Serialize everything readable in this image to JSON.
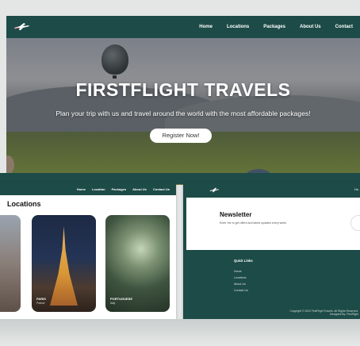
{
  "nav": {
    "links": [
      "Home",
      "Locations",
      "Packages",
      "About Us",
      "Contact"
    ]
  },
  "hero": {
    "title": "FIRSTFLIGHT TRAVELS",
    "subtitle": "Plan your trip with us and travel around the world with the most affordable packages!",
    "button": "Register Now!"
  },
  "locations_page": {
    "nav_links": [
      "Home",
      "Location",
      "Packages",
      "About Us",
      "Contact Us"
    ],
    "title": "Locations",
    "cards": [
      {
        "label": "",
        "sub": ""
      },
      {
        "label": "PARIS",
        "sub": "France"
      },
      {
        "label": "PORTUGUESE",
        "sub": "Italy"
      }
    ]
  },
  "newsletter_page": {
    "nav_tail": "Ho",
    "title": "Newsletter",
    "text": "Enter the to get offers and latest updates every week",
    "footer_heading": "Quick Links",
    "footer_links": [
      "Home",
      "Locations",
      "About Us",
      "Contact Us"
    ],
    "copyright": "Copyright © 2022 FirstFlight Travels. All Rights Reserved. Designed By: FirstFlight"
  },
  "colors": {
    "primary": "#1d4b47",
    "button_bg": "#ffffff"
  },
  "icons": {
    "logo": "plane-logo-icon"
  }
}
